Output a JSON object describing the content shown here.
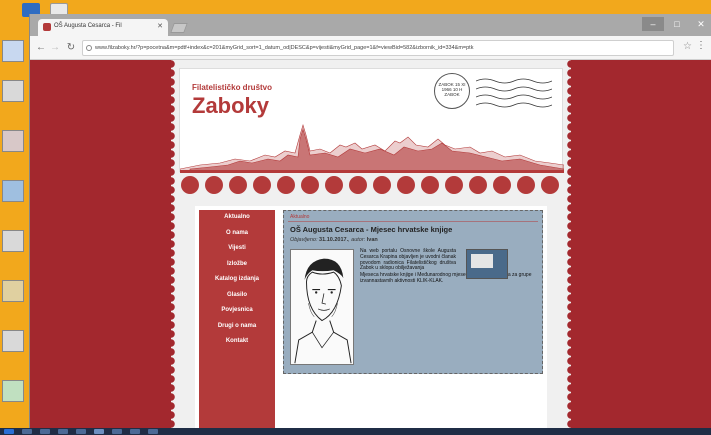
{
  "browser": {
    "tab_title": "OŠ Augusta Cesarca - Fil",
    "url": "www.filzaboky.hr/?p=pocetna&m=pdtf+index&c=201&myGrid_sort=1_datum_od|DESC&p=vijesti&myGrid_page=1&f=viewBid=582&izbornik_id=334&m=ptk",
    "win_min": "–",
    "win_max": "□",
    "win_close": "✕"
  },
  "site": {
    "brand_sub": "Filatelističko društvo",
    "brand_main": "Zaboky",
    "stamp_text": "ZABOK 15 XI 1966 10 H ZABOK"
  },
  "nav": [
    "Aktualno",
    "O nama",
    "Vijesti",
    "Izložbe",
    "Katalog izdanja",
    "Glasilo",
    "Povjesnica",
    "Drugi o nama",
    "Kontakt"
  ],
  "post": {
    "breadcrumb": "Aktualno",
    "title": "OŠ Augusta Cesarca - Mjesec hrvatske knjige",
    "meta_prefix": "Objavljeno: ",
    "date": "31.10.2017.",
    "meta_mid": ", autor: ",
    "author": "Ivan",
    "text_narrow": "Na web portalu Osnovne škole Augusta Cesarca Krapina objavljen je uvodni članak povodom radionica Filatelističkog društva Zabok u sklopu obilježavanja",
    "text_wide": "Mjeseca hrvatske knjige i Međunarodnog mjeseca školskih knjižnica za grupe izvannastavnih aktivnosti KLIK-KLAK."
  },
  "colors": {
    "brand_red": "#b33a3a",
    "page_bg": "#a3282e",
    "content_blue": "#99adbf"
  }
}
